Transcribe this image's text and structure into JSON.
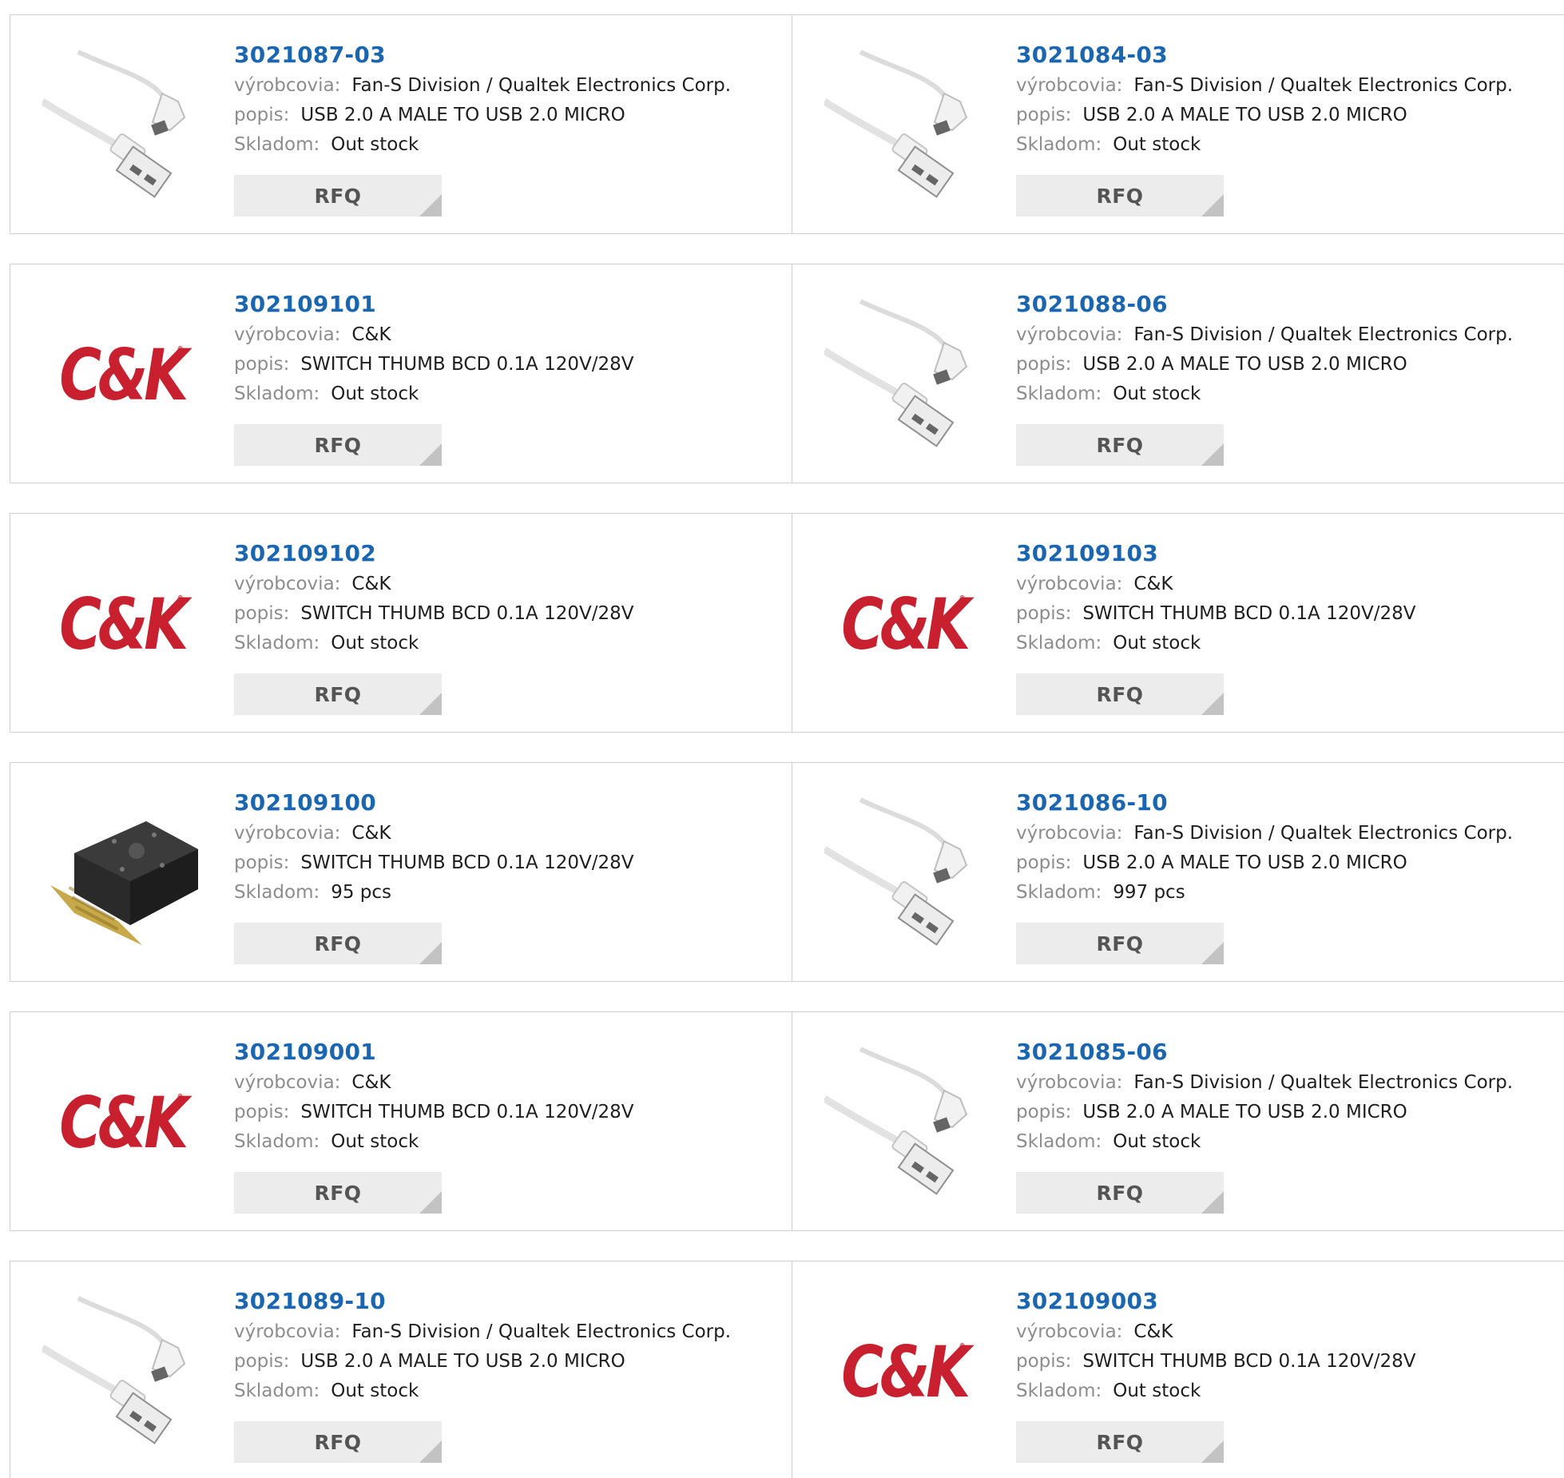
{
  "labels": {
    "manufacturer": "výrobcovia:",
    "description": "popis:",
    "stock": "Skladom:",
    "rfq": "RFQ"
  },
  "products": [
    {
      "pn": "3021087-03",
      "manufacturer": "Fan-S Division / Qualtek Electronics Corp.",
      "description": "USB 2.0 A MALE TO USB 2.0 MICRO",
      "stock": "Out stock",
      "image": "usb-cable-icon"
    },
    {
      "pn": "3021084-03",
      "manufacturer": "Fan-S Division / Qualtek Electronics Corp.",
      "description": "USB 2.0 A MALE TO USB 2.0 MICRO",
      "stock": "Out stock",
      "image": "usb-cable-icon"
    },
    {
      "pn": "302109101",
      "manufacturer": "C&K",
      "description": "SWITCH THUMB BCD 0.1A 120V/28V",
      "stock": "Out stock",
      "image": "ck-logo"
    },
    {
      "pn": "3021088-06",
      "manufacturer": "Fan-S Division / Qualtek Electronics Corp.",
      "description": "USB 2.0 A MALE TO USB 2.0 MICRO",
      "stock": "Out stock",
      "image": "usb-cable-icon"
    },
    {
      "pn": "302109102",
      "manufacturer": "C&K",
      "description": "SWITCH THUMB BCD 0.1A 120V/28V",
      "stock": "Out stock",
      "image": "ck-logo"
    },
    {
      "pn": "302109103",
      "manufacturer": "C&K",
      "description": "SWITCH THUMB BCD 0.1A 120V/28V",
      "stock": "Out stock",
      "image": "ck-logo"
    },
    {
      "pn": "302109100",
      "manufacturer": "C&K",
      "description": "SWITCH THUMB BCD 0.1A 120V/28V",
      "stock": "95 pcs",
      "image": "thumbwheel-switch-icon"
    },
    {
      "pn": "3021086-10",
      "manufacturer": "Fan-S Division / Qualtek Electronics Corp.",
      "description": "USB 2.0 A MALE TO USB 2.0 MICRO",
      "stock": "997 pcs",
      "image": "usb-cable-icon"
    },
    {
      "pn": "302109001",
      "manufacturer": "C&K",
      "description": "SWITCH THUMB BCD 0.1A 120V/28V",
      "stock": "Out stock",
      "image": "ck-logo"
    },
    {
      "pn": "3021085-06",
      "manufacturer": "Fan-S Division / Qualtek Electronics Corp.",
      "description": "USB 2.0 A MALE TO USB 2.0 MICRO",
      "stock": "Out stock",
      "image": "usb-cable-icon"
    },
    {
      "pn": "3021089-10",
      "manufacturer": "Fan-S Division / Qualtek Electronics Corp.",
      "description": "USB 2.0 A MALE TO USB 2.0 MICRO",
      "stock": "Out stock",
      "image": "usb-cable-icon"
    },
    {
      "pn": "302109003",
      "manufacturer": "C&K",
      "description": "SWITCH THUMB BCD 0.1A 120V/28V",
      "stock": "Out stock",
      "image": "ck-logo"
    }
  ],
  "logo": {
    "ck_text": "C&K",
    "ck_mark": "®"
  },
  "colors": {
    "link": "#1b66b1",
    "label": "#8d8d8d",
    "brand_red": "#c8202e",
    "button_bg": "#ececec"
  }
}
